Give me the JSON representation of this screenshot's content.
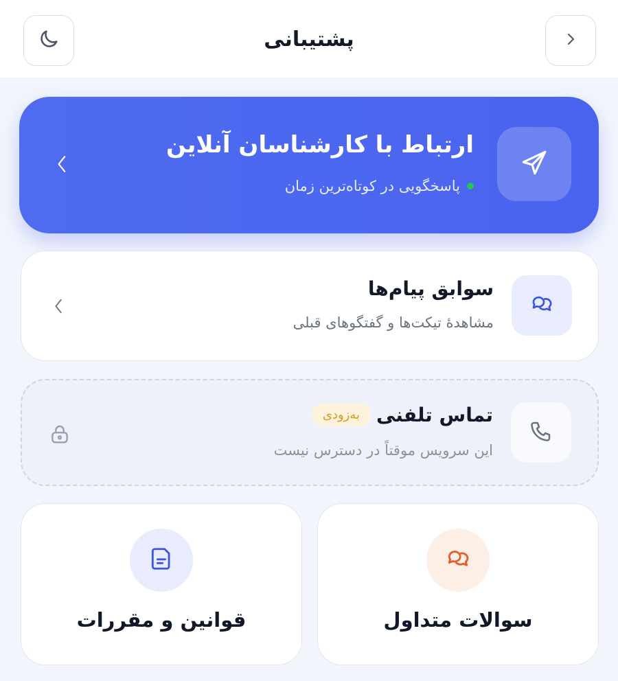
{
  "header": {
    "title": "پشتیبانی",
    "left_icon": "moon-icon",
    "right_icon": "chevron-right-icon"
  },
  "hero": {
    "title": "ارتباط با کارشناسان آنلاین",
    "subtitle": "پاسخگویی در کوتاه‌ترین زمان",
    "icon": "send-icon",
    "status_color": "#22c55e",
    "accent": "#4a63ef"
  },
  "history": {
    "title": "سوابق پیام‌ها",
    "subtitle": "مشاهدهٔ تیکت‌ها و گفتگوهای قبلی",
    "icon": "chat-bubbles-icon"
  },
  "phone": {
    "title": "تماس تلفنی",
    "badge": "به‌زودی",
    "subtitle": "این سرویس موقتاً در دسترس نیست",
    "icon": "phone-icon",
    "status_icon": "lock-icon"
  },
  "tiles": {
    "faq": {
      "label": "سوالات متداول",
      "icon": "chat-bubbles-icon",
      "color": "#e0622a"
    },
    "rules": {
      "label": "قوانین و مقررات",
      "icon": "document-icon",
      "color": "#3d56e0"
    }
  }
}
